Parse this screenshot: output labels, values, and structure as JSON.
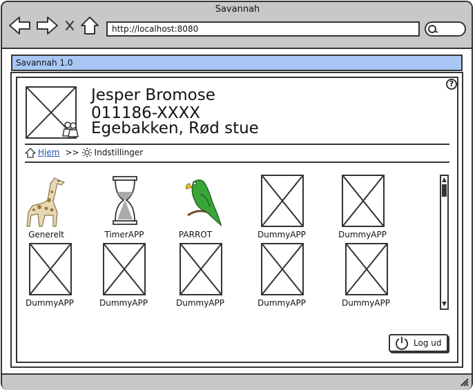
{
  "window": {
    "title": "Savannah"
  },
  "browser": {
    "url": "http://localhost:8080"
  },
  "app": {
    "title": "Savannah 1.0"
  },
  "profile": {
    "name": "Jesper Bromose",
    "cpr": "011186-XXXX",
    "location": "Egebakken, Rød stue"
  },
  "help": {
    "label": "?"
  },
  "breadcrumb": {
    "home": "Hjem",
    "separator": ">>",
    "current": "Indstillinger"
  },
  "apps": [
    {
      "label": "Generelt",
      "icon": "giraffe-icon"
    },
    {
      "label": "TimerAPP",
      "icon": "hourglass-icon"
    },
    {
      "label": "PARROT",
      "icon": "parrot-icon"
    },
    {
      "label": "DummyAPP",
      "icon": "placeholder-image"
    },
    {
      "label": "DummyAPP",
      "icon": "placeholder-image"
    },
    {
      "label": "DummyAPP",
      "icon": "placeholder-image"
    },
    {
      "label": "DummyAPP",
      "icon": "placeholder-image"
    },
    {
      "label": "DummyAPP",
      "icon": "placeholder-image"
    },
    {
      "label": "DummyAPP",
      "icon": "placeholder-image"
    },
    {
      "label": "DummyAPP",
      "icon": "placeholder-image"
    }
  ],
  "logout": {
    "label": "Log ud"
  },
  "colors": {
    "app_bar": "#a8c7f5",
    "chrome": "#c8c8c8",
    "link": "#1a4fa8"
  }
}
